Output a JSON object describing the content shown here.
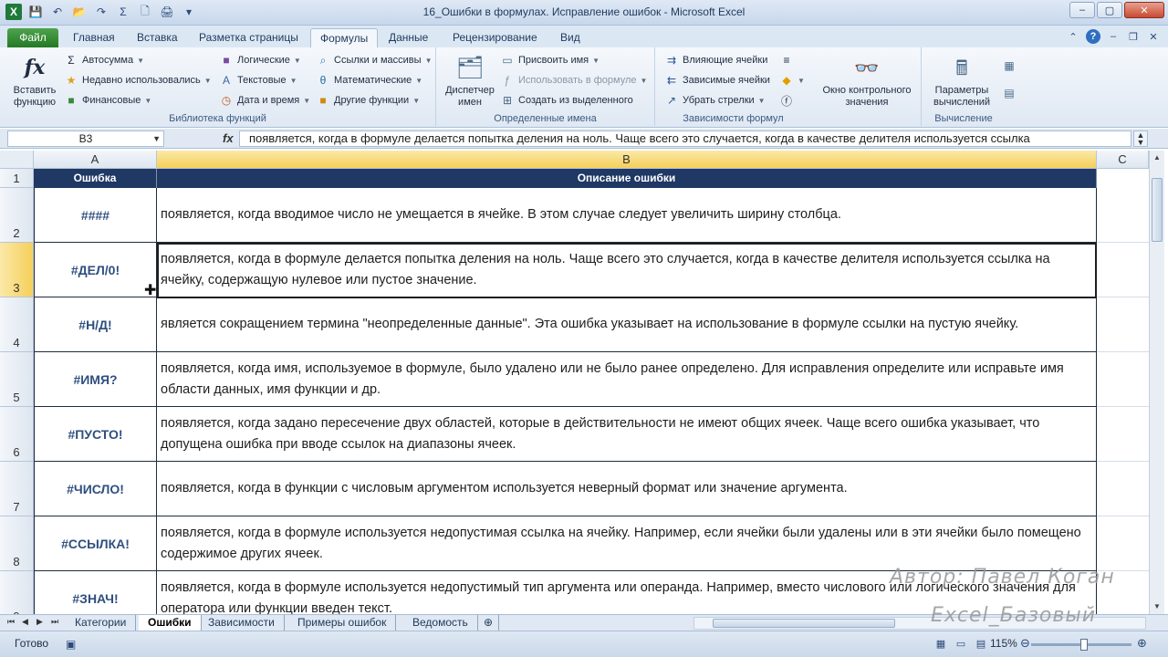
{
  "window": {
    "title": "16_Ошибки в формулах. Исправление ошибок - Microsoft Excel",
    "logo_letter": "X",
    "controls": [
      "–",
      "▢",
      "✕"
    ]
  },
  "tabs": [
    {
      "label": "Файл"
    },
    {
      "label": "Главная"
    },
    {
      "label": "Вставка"
    },
    {
      "label": "Разметка страницы"
    },
    {
      "label": "Формулы"
    },
    {
      "label": "Данные"
    },
    {
      "label": "Рецензирование"
    },
    {
      "label": "Вид"
    }
  ],
  "ribbon": {
    "insert_function": "Вставить функцию",
    "library": {
      "autosum": "Автосумма",
      "recent": "Недавно использовались",
      "financial": "Финансовые",
      "logical": "Логические",
      "text": "Текстовые",
      "datetime": "Дата и время",
      "lookup": "Ссылки и массивы",
      "math": "Математические",
      "other": "Другие функции",
      "label": "Библиотека функций"
    },
    "names": {
      "manager": "Диспетчер имен",
      "assign": "Присвоить имя",
      "use": "Использовать в формуле",
      "create": "Создать из выделенного",
      "label": "Определенные имена"
    },
    "audit": {
      "precedents": "Влияющие ячейки",
      "dependents": "Зависимые ячейки",
      "remove": "Убрать стрелки",
      "label": "Зависимости формул"
    },
    "watch": "Окно контрольного значения",
    "calc": {
      "options": "Параметры вычислений",
      "label": "Вычисление"
    }
  },
  "formula_bar": {
    "name_box": "B3",
    "fx": "fx",
    "content": "появляется, когда в формуле делается попытка деления на ноль. Чаще всего это случается, когда в качестве делителя используется ссылка"
  },
  "columns": [
    "A",
    "B",
    "C"
  ],
  "header_row": {
    "num": "1",
    "a": "Ошибка",
    "b": "Описание ошибки"
  },
  "rows": [
    {
      "num": "2",
      "error": "####",
      "desc": "появляется, когда вводимое число не умещается в ячейке. В этом случае следует увеличить ширину столбца."
    },
    {
      "num": "3",
      "error": "#ДЕЛ/0!",
      "desc": "появляется, когда в формуле делается попытка деления на ноль. Чаще всего это случается, когда в качестве делителя используется ссылка на ячейку, содержащую нулевое или пустое значение."
    },
    {
      "num": "4",
      "error": "#Н/Д!",
      "desc": "является сокращением термина \"неопределенные данные\". Эта ошибка указывает на использование в формуле ссылки на пустую ячейку."
    },
    {
      "num": "5",
      "error": "#ИМЯ?",
      "desc": "появляется, когда имя, используемое в формуле, было удалено или не было ранее определено. Для исправления определите или исправьте имя области данных, имя функции и др."
    },
    {
      "num": "6",
      "error": "#ПУСТО!",
      "desc": "появляется, когда задано пересечение двух областей, которые в действительности не имеют общих ячеек. Чаще всего ошибка указывает, что допущена ошибка при вводе ссылок на диапазоны ячеек."
    },
    {
      "num": "7",
      "error": "#ЧИСЛО!",
      "desc": "появляется, когда в функции с числовым аргументом используется неверный формат или значение аргумента."
    },
    {
      "num": "8",
      "error": "#ССЫЛКА!",
      "desc": "появляется, когда в формуле используется недопустимая ссылка на ячейку. Например, если ячейки были удалены или в эти ячейки было помещено содержимое других ячеек."
    },
    {
      "num": "9",
      "error": "#ЗНАЧ!",
      "desc": "появляется, когда в формуле используется недопустимый тип аргумента или операнда. Например, вместо числового или логического значения для оператора или функции введен текст."
    }
  ],
  "sheets": [
    {
      "label": "Категории"
    },
    {
      "label": "Ошибки"
    },
    {
      "label": "Зависимости"
    },
    {
      "label": "Примеры ошибок"
    },
    {
      "label": "Ведомость"
    }
  ],
  "status": {
    "ready": "Готово",
    "zoom": "115%"
  },
  "watermark": {
    "author": "Автор: Павел Коган",
    "course": "Excel_Базовый"
  }
}
